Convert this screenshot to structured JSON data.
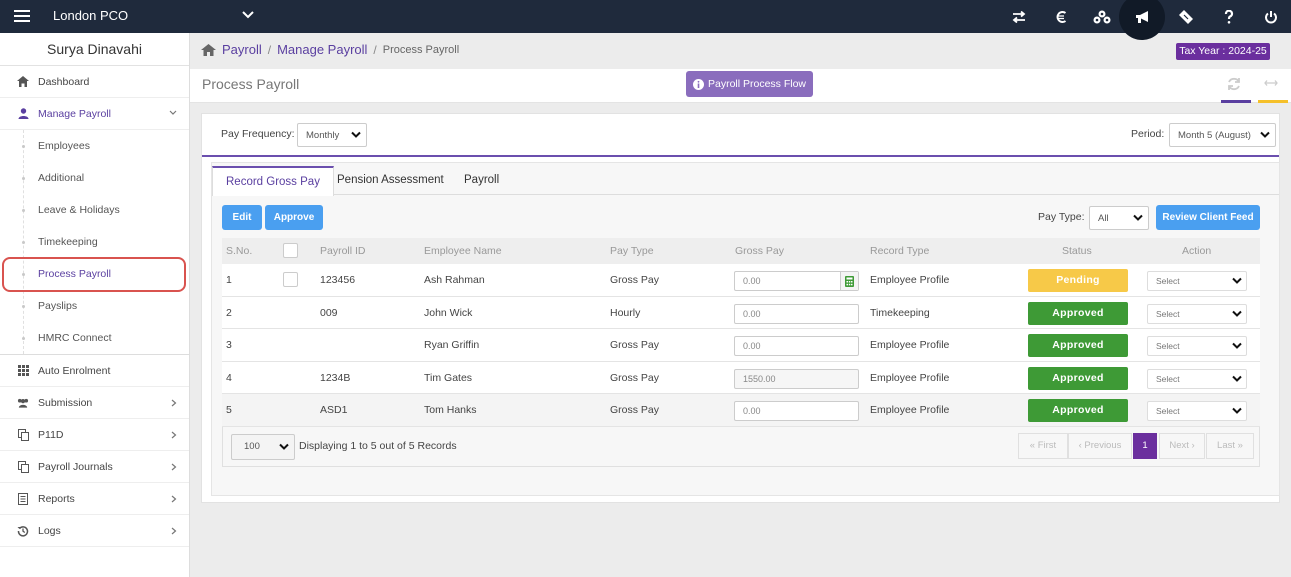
{
  "topbar": {
    "org_name": "London PCO",
    "icons": [
      "menu-icon",
      "chevron-down-icon",
      "transfer-icon",
      "currency-icon",
      "bank-icon",
      "announcement-icon",
      "ticket-icon",
      "help-icon",
      "power-icon"
    ],
    "bg_color": "#1f2a3c"
  },
  "sidebar": {
    "user_name": "Surya Dinavahi",
    "items": [
      {
        "label": "Dashboard",
        "icon": "home-icon"
      },
      {
        "label": "Manage Payroll",
        "icon": "user-icon",
        "expanded": true
      },
      {
        "label": "Auto Enrolment",
        "icon": "grid-icon"
      },
      {
        "label": "Submission",
        "icon": "users-icon"
      },
      {
        "label": "P11D",
        "icon": "copy-icon"
      },
      {
        "label": "Payroll Journals",
        "icon": "copy-icon"
      },
      {
        "label": "Reports",
        "icon": "report-icon"
      },
      {
        "label": "Logs",
        "icon": "history-icon"
      }
    ],
    "subitems": [
      "Employees",
      "Additional",
      "Leave & Holidays",
      "Timekeeping",
      "Process Payroll",
      "Payslips",
      "HMRC Connect"
    ],
    "active_subitem": "Process Payroll"
  },
  "breadcrumb": {
    "home": "Payroll",
    "parent": "Manage Payroll",
    "current": "Process Payroll"
  },
  "tax_year": "Tax Year : 2024-25",
  "page": {
    "title": "Process Payroll",
    "flow_button": "Payroll Process Flow"
  },
  "filters": {
    "pay_frequency_label": "Pay Frequency:",
    "pay_frequency_value": "Monthly",
    "period_label": "Period:",
    "period_value": "Month 5 (August)"
  },
  "tabs": [
    "Record Gross Pay",
    "Pension Assessment",
    "Payroll"
  ],
  "active_tab": "Record Gross Pay",
  "actions": {
    "edit": "Edit",
    "approve": "Approve",
    "pay_type_label": "Pay Type:",
    "pay_type_value": "All",
    "review": "Review Client Feed"
  },
  "table": {
    "columns": [
      "S.No.",
      "",
      "Payroll ID",
      "Employee Name",
      "Pay Type",
      "Gross Pay",
      "Record Type",
      "Status",
      "Action"
    ],
    "rows": [
      {
        "sno": "1",
        "payroll_id": "123456",
        "name": "Ash Rahman",
        "pay_type": "Gross Pay",
        "gross": "0.00",
        "record_type": "Employee Profile",
        "status": "Pending",
        "action": "Select"
      },
      {
        "sno": "2",
        "payroll_id": "009",
        "name": "John Wick",
        "pay_type": "Hourly",
        "gross": "0.00",
        "record_type": "Timekeeping",
        "status": "Approved",
        "action": "Select"
      },
      {
        "sno": "3",
        "payroll_id": "",
        "name": "Ryan Griffin",
        "pay_type": "Gross Pay",
        "gross": "0.00",
        "record_type": "Employee Profile",
        "status": "Approved",
        "action": "Select"
      },
      {
        "sno": "4",
        "payroll_id": "1234B",
        "name": "Tim Gates",
        "pay_type": "Gross Pay",
        "gross": "1550.00",
        "record_type": "Employee Profile",
        "status": "Approved",
        "action": "Select"
      },
      {
        "sno": "5",
        "payroll_id": "ASD1",
        "name": "Tom Hanks",
        "pay_type": "Gross Pay",
        "gross": "0.00",
        "record_type": "Employee Profile",
        "status": "Approved",
        "action": "Select"
      }
    ],
    "status_colors": {
      "Pending": "#f7c948",
      "Approved": "#3e9a36"
    }
  },
  "footer": {
    "page_size": "100",
    "summary": "Displaying 1 to 5 out of 5 Records",
    "first": "« First",
    "previous": "‹ Previous",
    "current_page": "1",
    "next": "Next ›",
    "last": "Last »"
  },
  "colors": {
    "accent": "#6b4fae",
    "primary_button": "#4a9ff0",
    "tax_year_bg": "#6b2f9e"
  }
}
